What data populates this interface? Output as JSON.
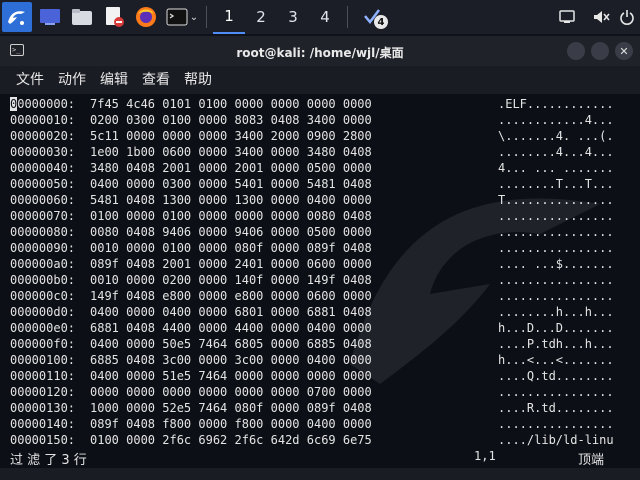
{
  "taskbar": {
    "workspaces": [
      "1",
      "2",
      "3",
      "4"
    ],
    "active_workspace": "1",
    "notification_count": "4",
    "icons": [
      "kali-menu-icon",
      "desktop-icon",
      "files-icon",
      "text-editor-icon",
      "firefox-icon",
      "terminal-icon"
    ]
  },
  "window": {
    "title": "root@kali: /home/wjl/桌面"
  },
  "menu": [
    "文件",
    "动作",
    "编辑",
    "查看",
    "帮助"
  ],
  "hexdump": [
    {
      "offset": "00000000:",
      "hex": "7f45 4c46 0101 0100 0000 0000 0000 0000",
      "ascii": ".ELF............"
    },
    {
      "offset": "00000010:",
      "hex": "0200 0300 0100 0000 8083 0408 3400 0000",
      "ascii": "............4..."
    },
    {
      "offset": "00000020:",
      "hex": "5c11 0000 0000 0000 3400 2000 0900 2800",
      "ascii": "\\.......4. ...(."
    },
    {
      "offset": "00000030:",
      "hex": "1e00 1b00 0600 0000 3400 0000 3480 0408",
      "ascii": "........4...4..."
    },
    {
      "offset": "00000040:",
      "hex": "3480 0408 2001 0000 2001 0000 0500 0000",
      "ascii": "4... ... ......."
    },
    {
      "offset": "00000050:",
      "hex": "0400 0000 0300 0000 5401 0000 5481 0408",
      "ascii": "........T...T..."
    },
    {
      "offset": "00000060:",
      "hex": "5481 0408 1300 0000 1300 0000 0400 0000",
      "ascii": "T..............."
    },
    {
      "offset": "00000070:",
      "hex": "0100 0000 0100 0000 0000 0000 0080 0408",
      "ascii": "................"
    },
    {
      "offset": "00000080:",
      "hex": "0080 0408 9406 0000 9406 0000 0500 0000",
      "ascii": "................"
    },
    {
      "offset": "00000090:",
      "hex": "0010 0000 0100 0000 080f 0000 089f 0408",
      "ascii": "................"
    },
    {
      "offset": "000000a0:",
      "hex": "089f 0408 2001 0000 2401 0000 0600 0000",
      "ascii": ".... ...$......."
    },
    {
      "offset": "000000b0:",
      "hex": "0010 0000 0200 0000 140f 0000 149f 0408",
      "ascii": "................"
    },
    {
      "offset": "000000c0:",
      "hex": "149f 0408 e800 0000 e800 0000 0600 0000",
      "ascii": "................"
    },
    {
      "offset": "000000d0:",
      "hex": "0400 0000 0400 0000 6801 0000 6881 0408",
      "ascii": "........h...h..."
    },
    {
      "offset": "000000e0:",
      "hex": "6881 0408 4400 0000 4400 0000 0400 0000",
      "ascii": "h...D...D......."
    },
    {
      "offset": "000000f0:",
      "hex": "0400 0000 50e5 7464 6805 0000 6885 0408",
      "ascii": "....P.tdh...h..."
    },
    {
      "offset": "00000100:",
      "hex": "6885 0408 3c00 0000 3c00 0000 0400 0000",
      "ascii": "h...<...<......."
    },
    {
      "offset": "00000110:",
      "hex": "0400 0000 51e5 7464 0000 0000 0000 0000",
      "ascii": "....Q.td........"
    },
    {
      "offset": "00000120:",
      "hex": "0000 0000 0000 0000 0000 0000 0700 0000",
      "ascii": "................"
    },
    {
      "offset": "00000130:",
      "hex": "1000 0000 52e5 7464 080f 0000 089f 0408",
      "ascii": "....R.td........"
    },
    {
      "offset": "00000140:",
      "hex": "089f 0408 f800 0000 f800 0000 0400 0000",
      "ascii": "................"
    },
    {
      "offset": "00000150:",
      "hex": "0100 0000 2f6c 6962 2f6c 642d 6c69 6e75",
      "ascii": "..../lib/ld-linu"
    }
  ],
  "cursor_char": "0",
  "status": {
    "message": "过 滤 了  3 行",
    "position": "1,1",
    "scroll": "顶端"
  },
  "colors": {
    "background": "#0c0f16",
    "text": "#e4e4e4",
    "accent": "#4f8ef7"
  }
}
